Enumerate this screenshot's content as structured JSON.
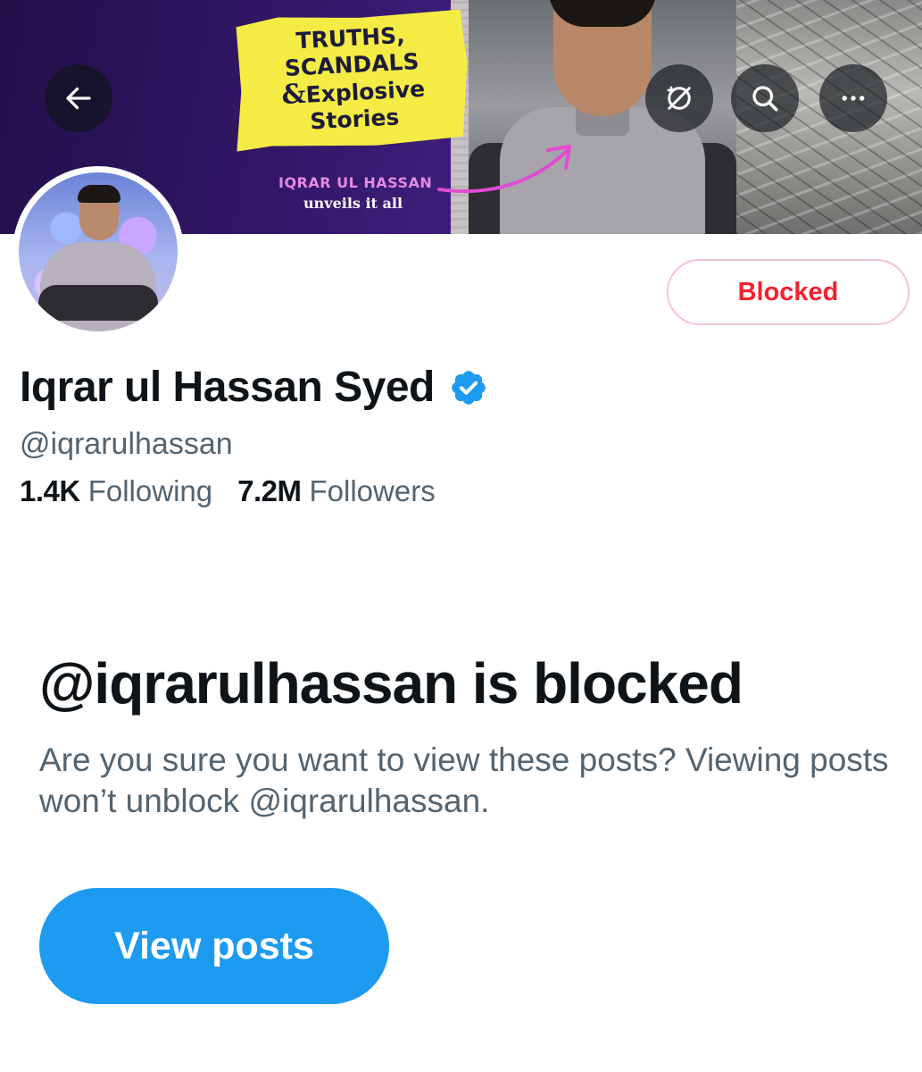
{
  "banner": {
    "sticky_line1": "TRUTHS,",
    "sticky_line2": "SCANDALS",
    "sticky_line3_amp": "&",
    "sticky_line3": "Explosive",
    "sticky_line4": "Stories",
    "name": "IQRAR UL HASSAN",
    "tagline": "unveils it all"
  },
  "toolbar": {
    "back_icon": "arrow-left-icon",
    "translate_icon": "translate-icon",
    "search_icon": "search-icon",
    "more_icon": "more-horizontal-icon"
  },
  "profile": {
    "blocked_label": "Blocked",
    "display_name": "Iqrar ul Hassan Syed",
    "verified_icon": "verified-badge-icon",
    "handle": "@iqrarulhassan",
    "following_count": "1.4K",
    "following_label": "Following",
    "followers_count": "7.2M",
    "followers_label": "Followers"
  },
  "notice": {
    "title": "@iqrarulhassan is blocked",
    "body": "Are you sure you want to view these posts? Viewing posts won’t unblock @iqrarulhassan.",
    "button_label": "View posts"
  },
  "colors": {
    "accent": "#1d9bf0",
    "blocked_red": "#f4212e",
    "secondary_text": "#536471",
    "primary_text": "#0f1419"
  }
}
